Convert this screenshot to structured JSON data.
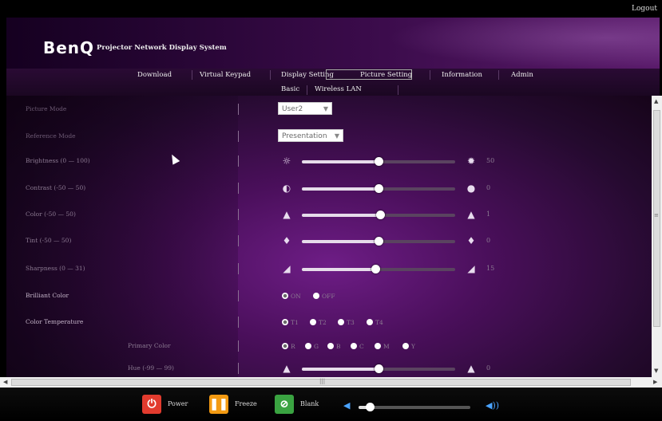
{
  "app": {
    "logout_label": "Logout",
    "brand": "BenQ",
    "subtitle": "Projector Network Display System"
  },
  "nav": {
    "tabs": [
      "Download",
      "Virtual Keypad",
      "Display Setting",
      "Picture Setting",
      "Information",
      "Admin"
    ],
    "selected_tab": "Picture Setting",
    "subtabs": [
      "Basic",
      "Wireless LAN"
    ]
  },
  "settings": {
    "picture_mode": {
      "label": "Picture Mode",
      "value": "User2"
    },
    "reference_mode": {
      "label": "Reference Mode",
      "value": "Presentation"
    },
    "brightness": {
      "label": "Brightness (0 — 100)",
      "value": "50",
      "level": 0.5
    },
    "contrast": {
      "label": "Contrast (-50 — 50)",
      "value": "0",
      "level": 0.5
    },
    "color": {
      "label": "Color (-50 — 50)",
      "value": "1",
      "level": 0.51
    },
    "tint": {
      "label": "Tint (-50 — 50)",
      "value": "0",
      "level": 0.5
    },
    "sharpness": {
      "label": "Sharpness (0 — 31)",
      "value": "15",
      "level": 0.48
    },
    "brilliant_color": {
      "label": "Brilliant Color",
      "options": [
        "ON",
        "OFF"
      ],
      "selected": "ON"
    },
    "color_temperature": {
      "label": "Color Temperature",
      "options": [
        "T1",
        "T2",
        "T3",
        "T4"
      ],
      "selected": "T1"
    },
    "primary_color": {
      "label": "Primary Color",
      "options": [
        "R",
        "G",
        "B",
        "C",
        "M",
        "Y"
      ],
      "selected": "R"
    },
    "hue": {
      "label": "Hue (-99 — 99)",
      "value": "0",
      "level": 0.5
    }
  },
  "footer": {
    "power": "Power",
    "freeze": "Freeze",
    "blank": "Blank",
    "volume_level": 0.1
  },
  "colors": {
    "power": "#e23b2e",
    "freeze": "#f39a12",
    "blank": "#3aa341",
    "accent": "#6e1d86"
  },
  "icons": {
    "power": "power-icon",
    "freeze": "pause-icon",
    "blank": "blank-icon",
    "volume_down": "speaker-low-icon",
    "volume_up": "speaker-high-icon"
  }
}
